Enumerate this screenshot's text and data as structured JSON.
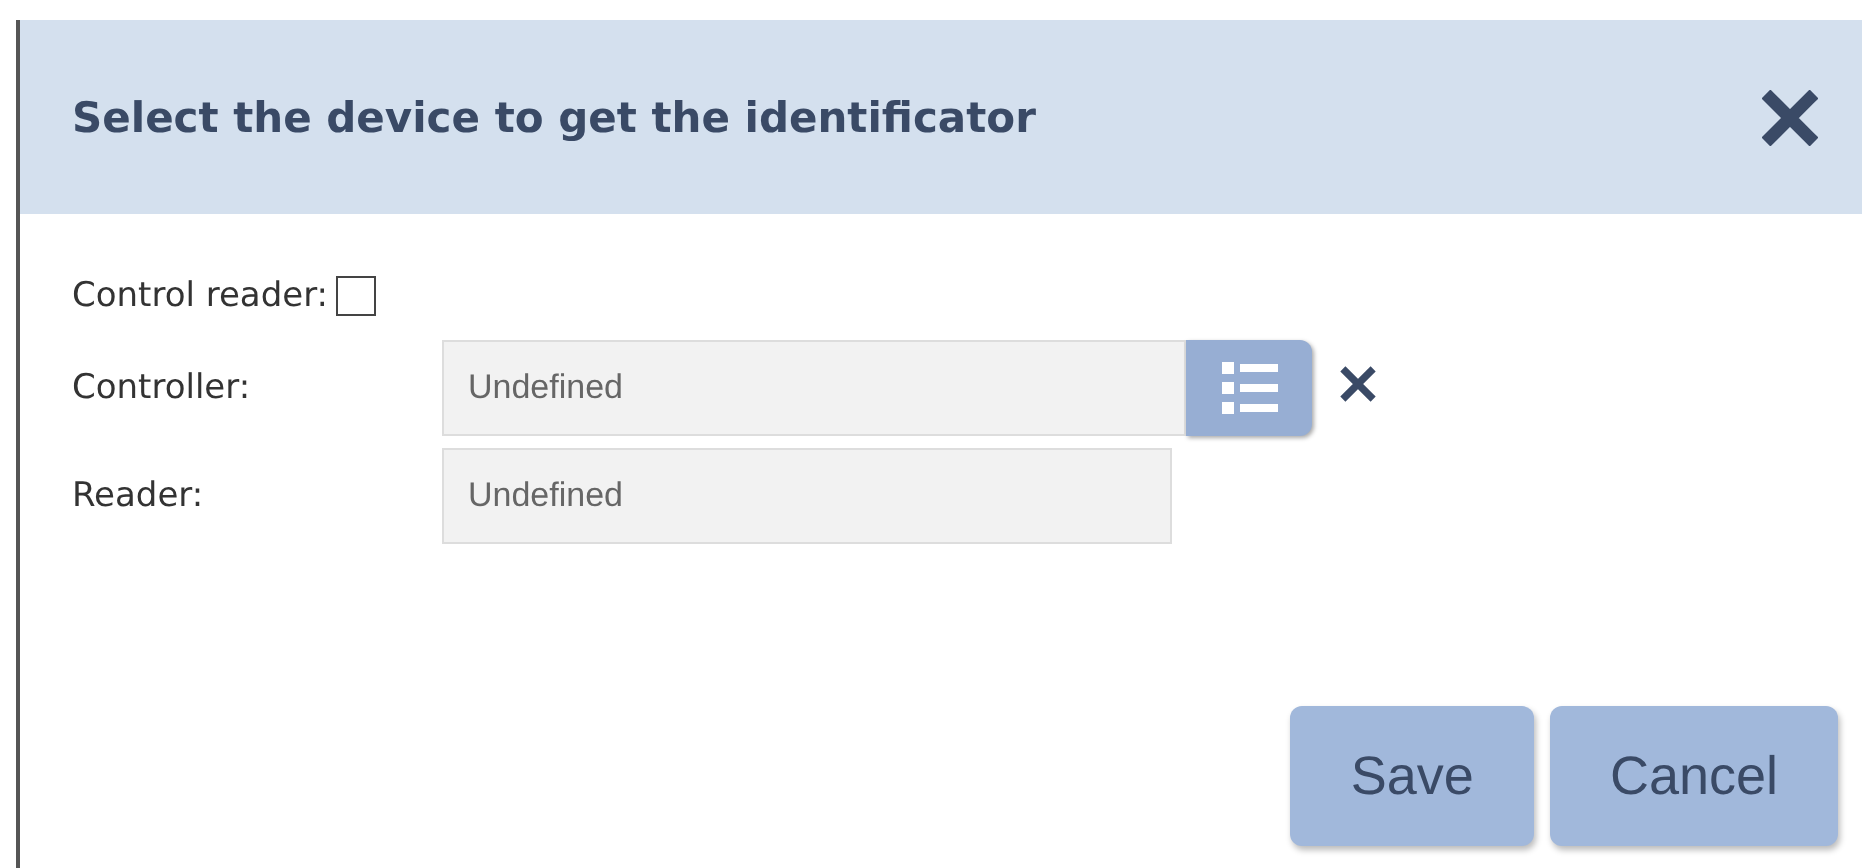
{
  "dialog": {
    "title": "Select the device to get the identificator"
  },
  "fields": [
    {
      "kind": "checkbox",
      "label": "Control reader:",
      "checked": false
    },
    {
      "kind": "picker",
      "label": "Controller:",
      "value": "Undefined"
    },
    {
      "kind": "text",
      "label": "Reader:",
      "value": "Undefined"
    }
  ],
  "buttons": [
    "Save",
    "Cancel"
  ]
}
